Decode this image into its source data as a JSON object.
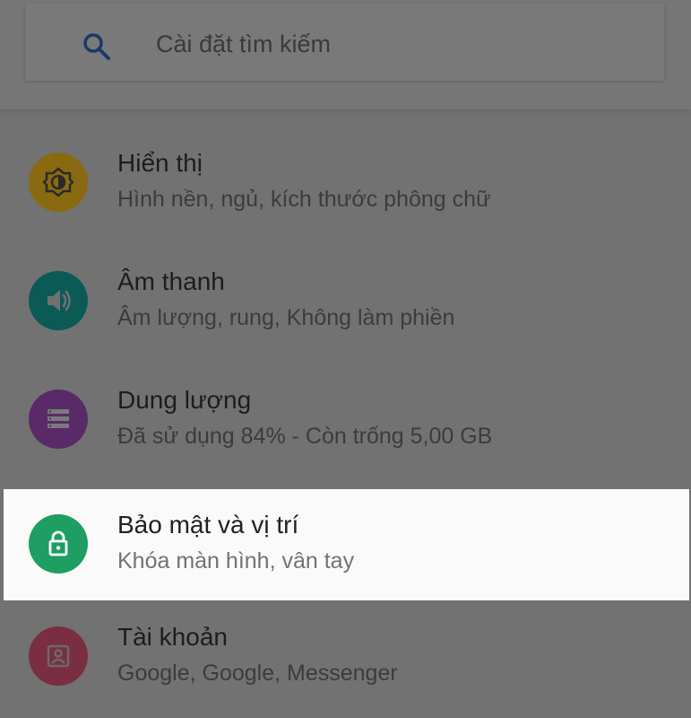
{
  "search": {
    "placeholder": "Cài đặt tìm kiếm",
    "icon": "search-icon"
  },
  "colors": {
    "overlay_bg": "#727272",
    "highlight_bg": "#fafafa",
    "search_icon": "#1a3a66"
  },
  "settings": [
    {
      "title": "Hiển thị",
      "subtitle": "Hình nền, ngủ, kích thước phông chữ",
      "icon": "brightness-icon",
      "color": "#8a6a10"
    },
    {
      "title": "Âm thanh",
      "subtitle": "Âm lượng, rung, Không làm phiền",
      "icon": "volume-icon",
      "color": "#0b5a56"
    },
    {
      "title": "Dung lượng",
      "subtitle": "Đã sử dụng 84% - Còn trống 5,00 GB",
      "icon": "storage-icon",
      "color": "#5a2a68"
    },
    {
      "title": "Bảo mật và vị trí",
      "subtitle": "Khóa màn hình, vân tay",
      "icon": "lock-icon",
      "color": "#1e9e62"
    },
    {
      "title": "Tài khoản",
      "subtitle": "Google, Google, Messenger",
      "icon": "account-icon",
      "color": "#7a2e42"
    }
  ]
}
